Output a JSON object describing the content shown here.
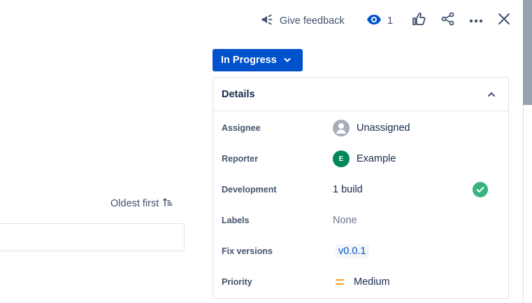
{
  "topbar": {
    "feedback_label": "Give feedback",
    "watch_count": "1"
  },
  "status": {
    "label": "In Progress"
  },
  "details": {
    "title": "Details",
    "fields": {
      "assignee": {
        "label": "Assignee",
        "value": "Unassigned"
      },
      "reporter": {
        "label": "Reporter",
        "value": "Example",
        "initial": "E"
      },
      "development": {
        "label": "Development",
        "value": "1 build"
      },
      "labels": {
        "label": "Labels",
        "value": "None"
      },
      "fix_versions": {
        "label": "Fix versions",
        "value": "v0.0.1"
      },
      "priority": {
        "label": "Priority",
        "value": "Medium"
      }
    }
  },
  "activity": {
    "sort_label": "Oldest first"
  },
  "colors": {
    "primary": "#0052cc",
    "success": "#36b37e",
    "priority_medium": "#ff991f",
    "reporter_avatar": "#00875a"
  }
}
